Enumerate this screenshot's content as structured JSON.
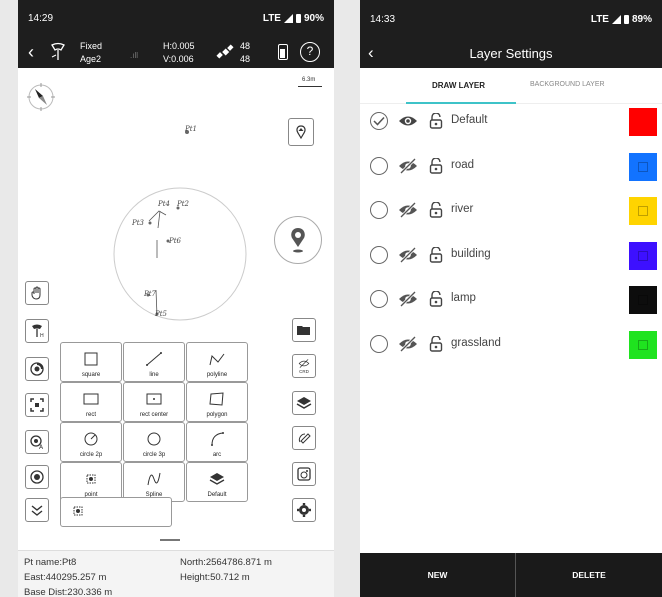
{
  "left_screen": {
    "status": {
      "time": "14:29",
      "network": "LTE",
      "battery": "90%"
    },
    "gps": {
      "fix": "Fixed",
      "age": "Age2",
      "h_precision": "H:0.005",
      "v_precision": "V:0.006",
      "sats_top": "48",
      "sats_bottom": "48"
    },
    "scale_label": "6.3m",
    "points": [
      "Pt1",
      "Pt4",
      "Pt2",
      "Pt3",
      "Pt6",
      "Pt7",
      "Pt5"
    ],
    "draw_tools": [
      {
        "label": "square",
        "icon": "square-icon"
      },
      {
        "label": "line",
        "icon": "line-icon"
      },
      {
        "label": "polyline",
        "icon": "polyline-icon"
      },
      {
        "label": "rect",
        "icon": "rect-icon"
      },
      {
        "label": "rect center",
        "icon": "rect-center-icon"
      },
      {
        "label": "polygon",
        "icon": "polygon-icon"
      },
      {
        "label": "circle 2p",
        "icon": "circle-2p-icon"
      },
      {
        "label": "circle 3p",
        "icon": "circle-3p-icon"
      },
      {
        "label": "arc",
        "icon": "arc-icon"
      },
      {
        "label": "point",
        "icon": "point-icon"
      },
      {
        "label": "Spline",
        "icon": "spline-icon"
      },
      {
        "label": "Default",
        "icon": "layers-icon"
      }
    ],
    "right_tool_labels": {
      "crd": "CRD"
    },
    "info": {
      "pt_name": "Pt name:Pt8",
      "north": "North:2564786.871 m",
      "east": "East:440295.257 m",
      "height": "Height:50.712 m",
      "base_dist": "Base Dist:230.336 m"
    }
  },
  "right_screen": {
    "status": {
      "time": "14:33",
      "network": "LTE",
      "battery": "89%"
    },
    "title": "Layer Settings",
    "tabs": {
      "draw": "DRAW LAYER",
      "background": "BACKGROUND LAYER"
    },
    "layers": [
      {
        "name": "Default",
        "checked": true,
        "visible": true,
        "color": "#ff0000"
      },
      {
        "name": "road",
        "checked": false,
        "visible": false,
        "color": "#1273ff"
      },
      {
        "name": "river",
        "checked": false,
        "visible": false,
        "color": "#ffd400"
      },
      {
        "name": "building",
        "checked": false,
        "visible": false,
        "color": "#3d10ff"
      },
      {
        "name": "lamp",
        "checked": false,
        "visible": false,
        "color": "#0d0d0d"
      },
      {
        "name": "grassland",
        "checked": false,
        "visible": false,
        "color": "#1fe31f"
      }
    ],
    "buttons": {
      "new": "NEW",
      "delete": "DELETE"
    }
  }
}
